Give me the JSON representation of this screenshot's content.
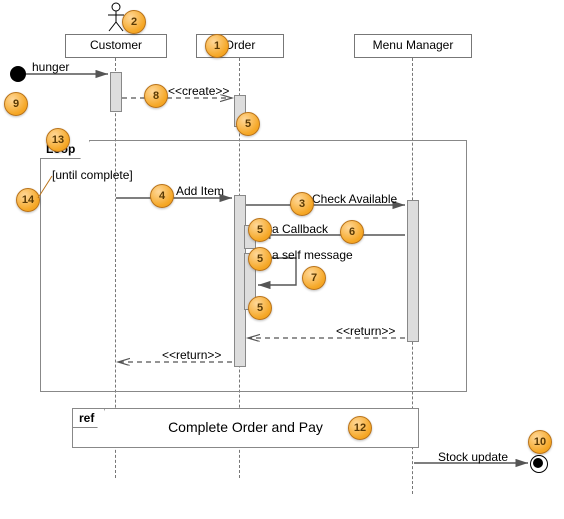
{
  "lifelines": {
    "customer": "Customer",
    "order": "Order",
    "menu": "Menu Manager"
  },
  "messages": {
    "hunger": "hunger",
    "create": "<<create>>",
    "addItem": "Add Item",
    "checkAvailable": "Check Available",
    "callback": "a Callback",
    "selfmsg": "a self message",
    "return1": "<<return>>",
    "return2": "<<return>>",
    "stockUpdate": "Stock update"
  },
  "fragments": {
    "loop": {
      "title": "Loop",
      "guard": "[until complete]"
    },
    "ref": {
      "title": "ref",
      "label": "Complete Order and Pay"
    }
  },
  "callouts": {
    "c1": "1",
    "c2": "2",
    "c3": "3",
    "c4": "4",
    "c5a": "5",
    "c5b": "5",
    "c5c": "5",
    "c5d": "5",
    "c6": "6",
    "c7": "7",
    "c8": "8",
    "c9": "9",
    "c10": "10",
    "c12": "12",
    "c13": "13",
    "c14": "14"
  }
}
